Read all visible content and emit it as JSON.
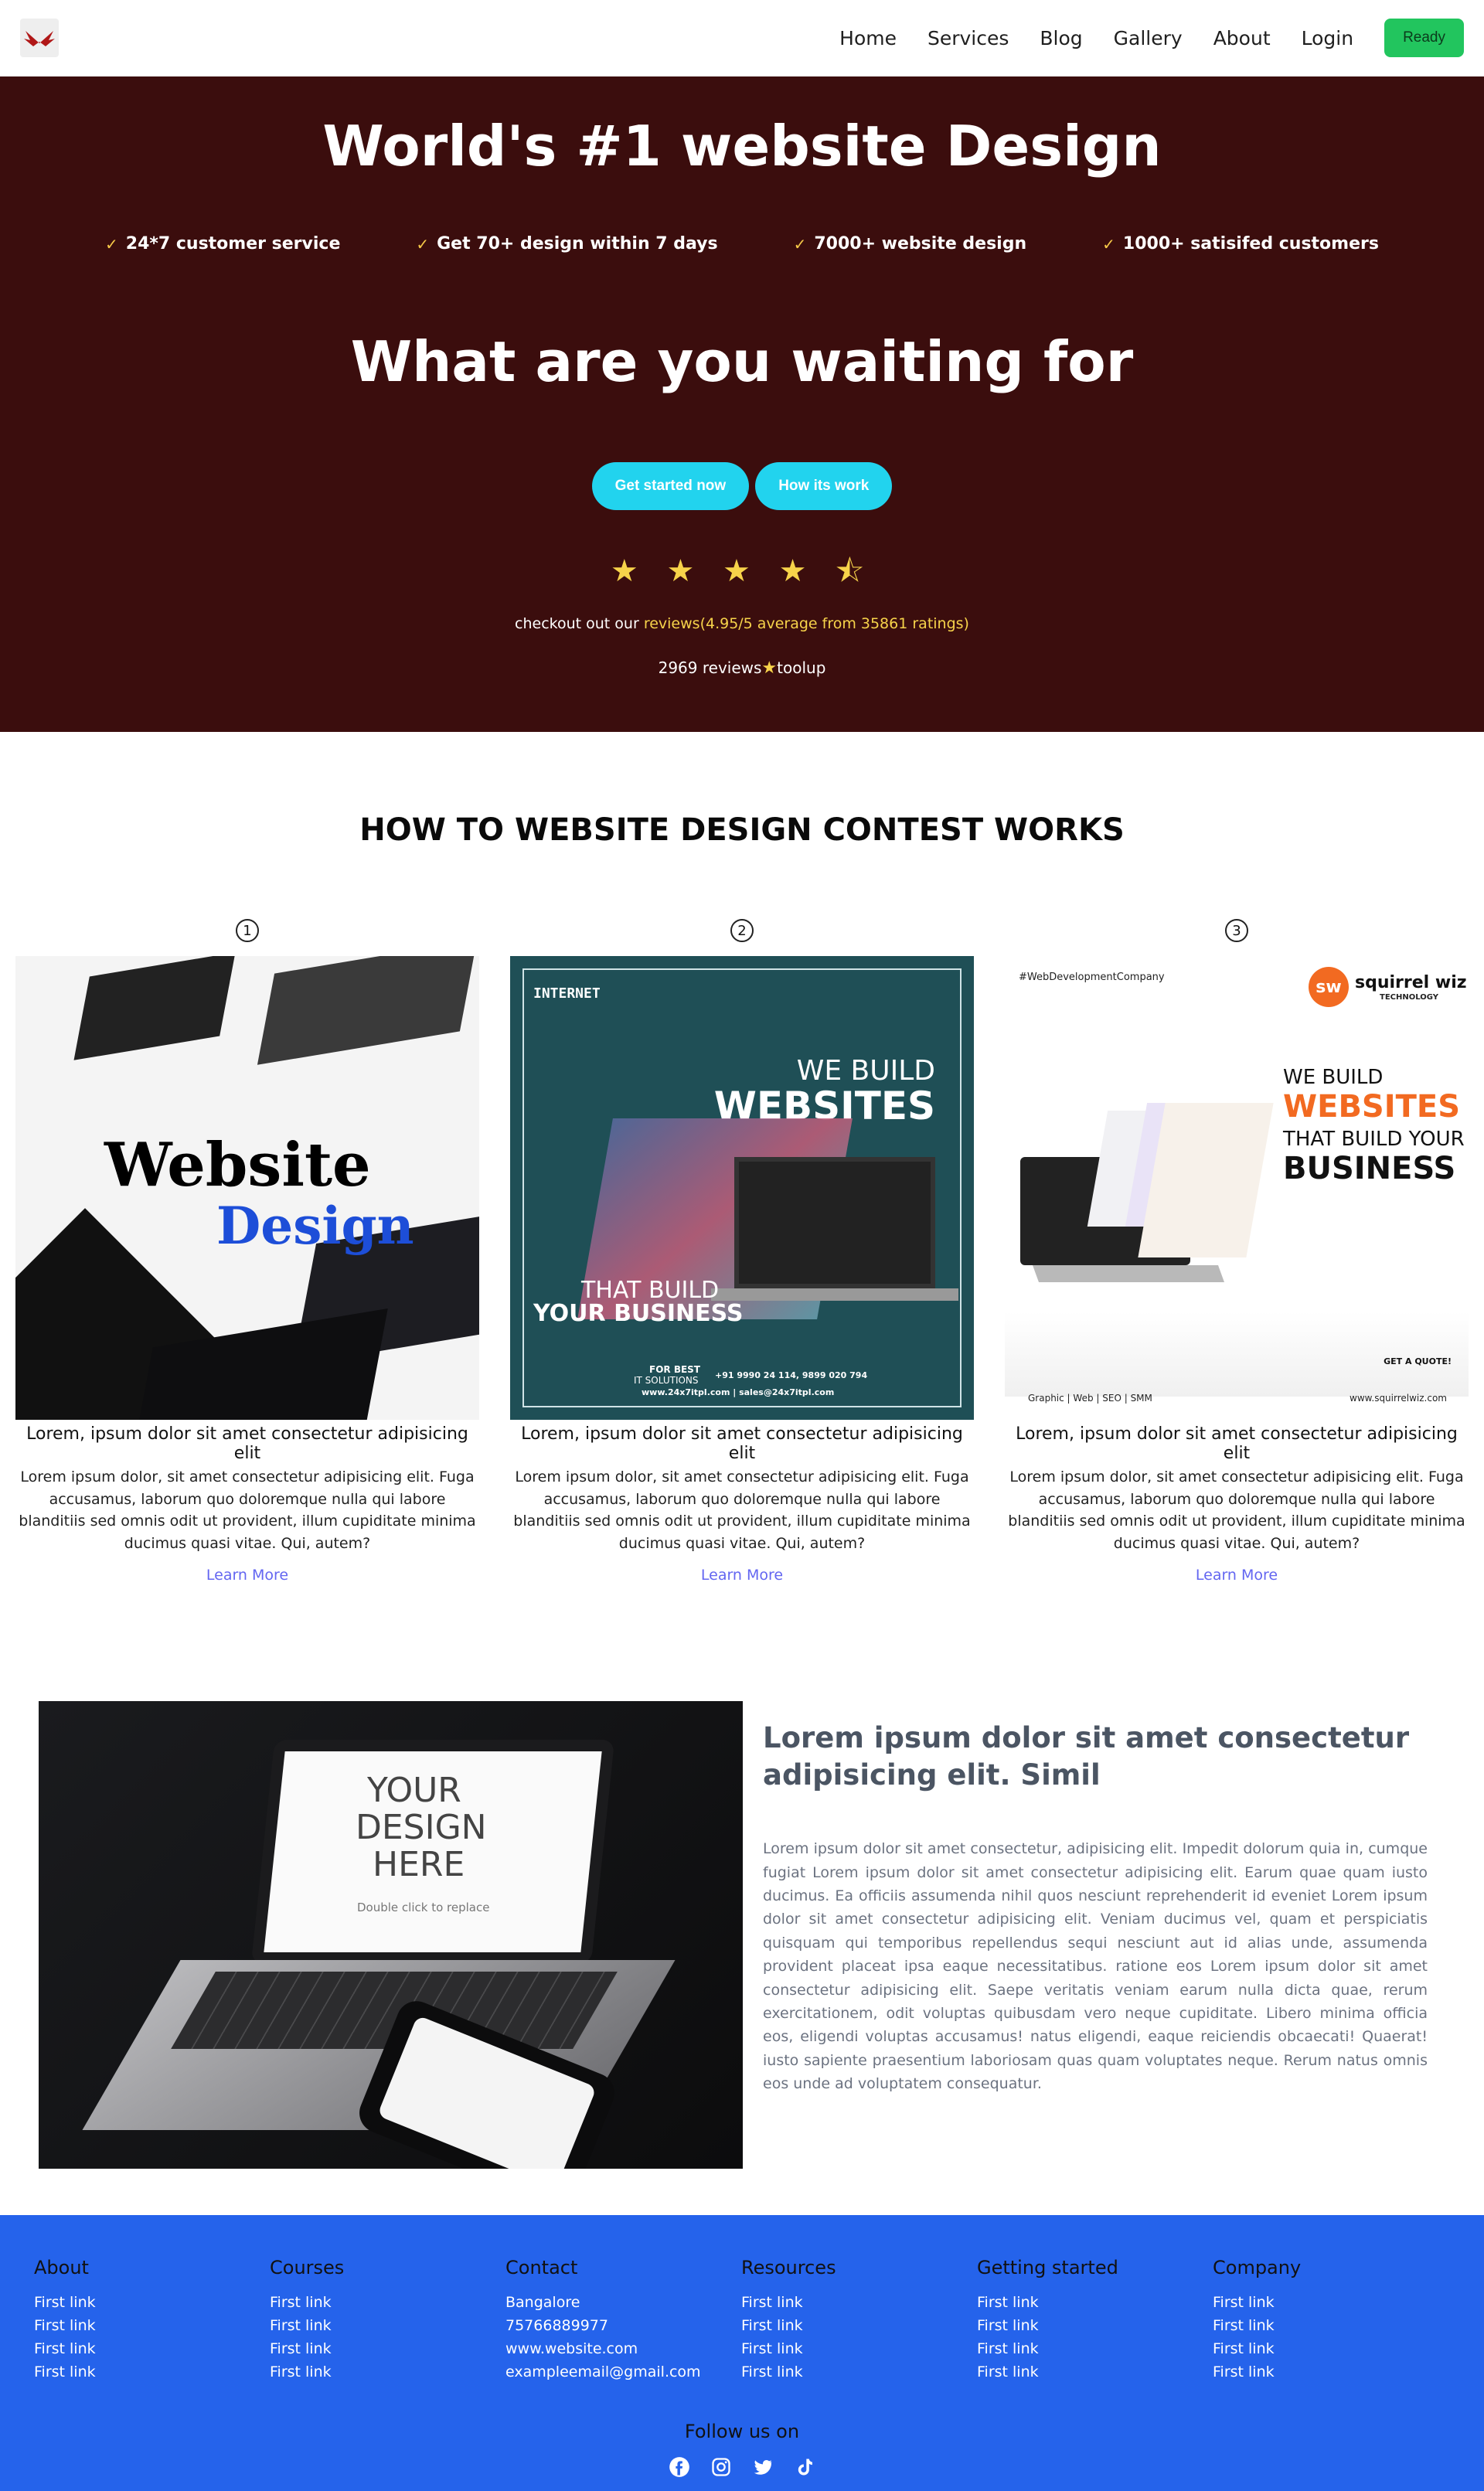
{
  "nav": {
    "links": [
      "Home",
      "Services",
      "Blog",
      "Gallery",
      "About",
      "Login"
    ],
    "ready_label": "Ready"
  },
  "hero": {
    "title": "World's #1 website Design",
    "features": [
      "24*7 customer service",
      "Get 70+ design within 7 days",
      "7000+ website design",
      "1000+ satisifed customers"
    ],
    "subtitle": "What are you waiting for",
    "btn_start": "Get started now",
    "btn_how": "How its work",
    "stars": "★ ★ ★ ★ ⯪",
    "ratings_prefix": "checkout out our",
    "ratings_link": "reviews(4.95/5 average from 35861 ratings)",
    "reviews_count": "2969 reviews",
    "reviews_suffix": "toolup"
  },
  "howto": {
    "title": "HOW TO WEBSITE DESIGN CONTEST WORKS",
    "steps": [
      {
        "num": "1",
        "title": "Lorem, ipsum dolor sit amet consectetur adipisicing elit",
        "text": "Lorem ipsum dolor, sit amet consectetur adipisicing elit. Fuga accusamus, laborum quo doloremque nulla qui labore blanditiis sed omnis odit ut provident, illum cupiditate minima ducimus quasi vitae. Qui, autem?",
        "link": "Learn More"
      },
      {
        "num": "2",
        "title": "Lorem, ipsum dolor sit amet consectetur adipisicing elit",
        "text": "Lorem ipsum dolor, sit amet consectetur adipisicing elit. Fuga accusamus, laborum quo doloremque nulla qui labore blanditiis sed omnis odit ut provident, illum cupiditate minima ducimus quasi vitae. Qui, autem?",
        "link": "Learn More"
      },
      {
        "num": "3",
        "title": "Lorem, ipsum dolor sit amet consectetur adipisicing elit",
        "text": "Lorem ipsum dolor, sit amet consectetur adipisicing elit. Fuga accusamus, laborum quo doloremque nulla qui labore blanditiis sed omnis odit ut provident, illum cupiditate minima ducimus quasi vitae. Qui, autem?",
        "link": "Learn More"
      }
    ],
    "img1": {
      "line1": "Website",
      "line2": "Design"
    },
    "img2": {
      "brand": "INTERNET",
      "top": "WE BUILD",
      "big": "WEBSITES",
      "bottom1": "THAT BUILD",
      "bottom2": "YOUR BUSINESS",
      "best": "FOR BEST",
      "it": "IT SOLUTIONS",
      "phone": "+91 9990 24 114, 9899 020 794",
      "web": "www.24x7itpl.com  |  sales@24x7itpl.com"
    },
    "img3": {
      "tag": "#WebDevelopmentCompany",
      "brand": "squirrel wiz",
      "brand_sub": "TECHNOLOGY",
      "l1": "WE BUILD",
      "l2": "WEBSITES",
      "l3": "THAT BUILD YOUR",
      "l4": "BUSINESS",
      "quote": "GET A QUOTE!",
      "services": "Graphic | Web | SEO | SMM",
      "site": "www.squirrelwiz.com"
    }
  },
  "feature": {
    "mock_line1": "YOUR",
    "mock_line2": "DESIGN",
    "mock_line3": "HERE",
    "mock_hint": "Double click to replace",
    "title": "Lorem ipsum dolor sit amet consectetur adipisicing elit. Simil",
    "body": "Lorem ipsum dolor sit amet consectetur, adipisicing elit. Impedit dolorum quia in, cumque fugiat Lorem ipsum dolor sit amet consectetur adipisicing elit. Earum quae quam iusto ducimus. Ea officiis assumenda nihil quos nesciunt reprehenderit id eveniet Lorem ipsum dolor sit amet consectetur adipisicing elit. Veniam ducimus vel, quam et perspiciatis quisquam qui temporibus repellendus sequi nesciunt aut id alias unde, assumenda provident placeat ipsa eaque necessitatibus. ratione eos Lorem ipsum dolor sit amet consectetur adipisicing elit. Saepe veritatis veniam earum nulla dicta quae, rerum exercitationem, odit voluptas quibusdam vero neque cupiditate. Libero minima officia eos, eligendi voluptas accusamus! natus eligendi, eaque reiciendis obcaecati! Quaerat! iusto sapiente praesentium laboriosam quas quam voluptates neque. Rerum natus omnis eos unde ad voluptatem consequatur."
  },
  "footer": {
    "columns": [
      {
        "title": "About",
        "links": [
          "First link",
          "First link",
          "First link",
          "First link"
        ]
      },
      {
        "title": "Courses",
        "links": [
          "First link",
          "First link",
          "First link",
          "First link"
        ]
      },
      {
        "title": "Contact",
        "links": [
          "Bangalore",
          "75766889977",
          "www.website.com",
          "exampleemail@gmail.com"
        ]
      },
      {
        "title": "Resources",
        "links": [
          "First link",
          "First link",
          "First link",
          "First link"
        ]
      },
      {
        "title": "Getting started",
        "links": [
          "First link",
          "First link",
          "First link",
          "First link"
        ]
      },
      {
        "title": "Company",
        "links": [
          "First link",
          "First link",
          "First link",
          "First link"
        ]
      }
    ],
    "follow": "Follow us on",
    "socials": [
      "facebook-icon",
      "instagram-icon",
      "twitter-icon",
      "tiktok-icon"
    ]
  },
  "colors": {
    "hero_bg": "#3b0d0d",
    "accent_cyan": "#22d3ee",
    "ready_green": "#22c55e",
    "footer_blue": "#2563eb",
    "star": "#f7d34a",
    "link": "#6366f1"
  }
}
